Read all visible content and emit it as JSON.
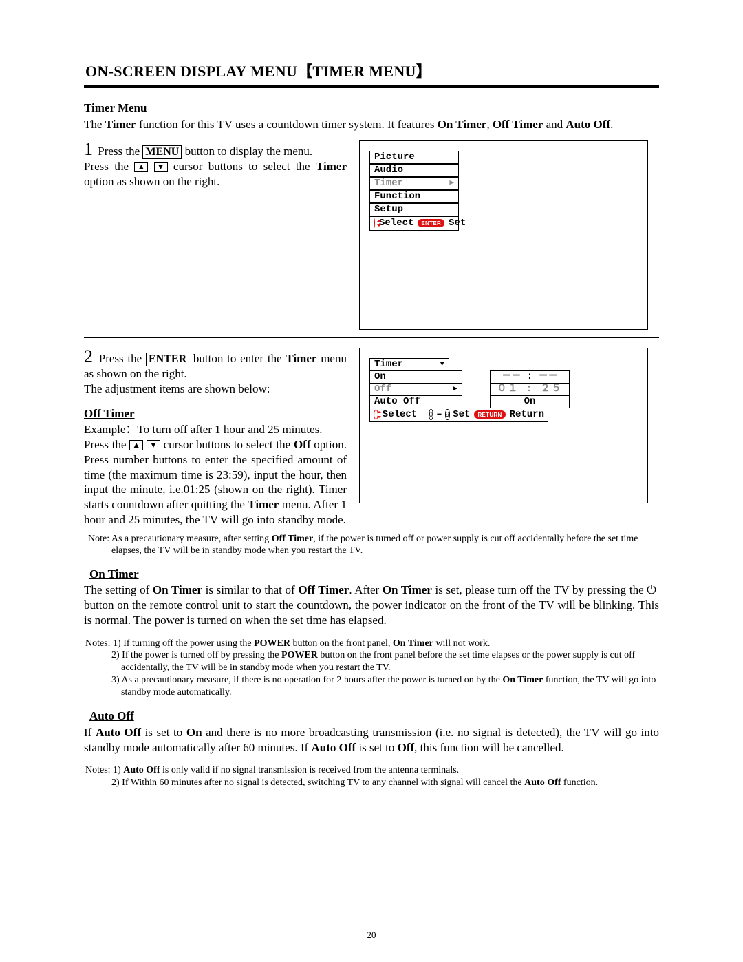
{
  "heading": "ON-SCREEN DISPLAY MENU【TIMER MENU】",
  "subheading": "Timer Menu",
  "intro_pre": "The ",
  "intro_b1": "Timer",
  "intro_mid1": " function for this TV uses a countdown timer system. It features ",
  "intro_b2": "On Timer",
  "intro_mid2": ", ",
  "intro_b3": "Off Timer",
  "intro_mid3": " and ",
  "intro_b4": "Auto Off",
  "intro_end": ".",
  "step1_num": "1",
  "step1_a": " Press the ",
  "step1_menu": "MENU",
  "step1_b": " button to display the menu.",
  "step1_c": "Press the ",
  "step1_d": " cursor buttons to select the ",
  "step1_timer": "Timer",
  "step1_e": " option as shown on the right.",
  "arrow_up": "▲",
  "arrow_down": "▼",
  "arrow_right": "▶",
  "menu1": {
    "items": [
      "Picture",
      "Audio",
      "Timer",
      "Function",
      "Setup"
    ],
    "status_select": "Select",
    "status_enter": "ENTER",
    "status_set": "Set"
  },
  "step2_num": "2",
  "step2_a": " Press the ",
  "step2_enter": "ENTER",
  "step2_b": " button to enter the ",
  "step2_timer": "Timer",
  "step2_c": " menu as shown on the right.",
  "step2_d": "The adjustment items are shown below:",
  "off_timer_title": "Off Timer",
  "off_timer_example": "Example：To turn off after 1 hour and 25 minutes.",
  "off_timer_p_a": "Press the ",
  "off_timer_p_b": " cursor buttons to select the ",
  "off_timer_off": "Off",
  "off_timer_p_c": " option. Press number buttons to enter the specified amount of time (the maximum time is 23:59), input the hour, then input the minute, i.e.01:25 (shown on the right). Timer starts countdown after quitting the ",
  "off_timer_timer": "Timer",
  "off_timer_p_d": " menu. After 1 hour and 25 minutes, the TV will go into standby mode.",
  "menu2": {
    "header": "Timer",
    "rows": [
      {
        "label": "On",
        "value": "－－ : －－"
      },
      {
        "label": "Off",
        "value": "０１ : ２５",
        "gray": true
      },
      {
        "label": "Auto Off",
        "value": "On"
      }
    ],
    "status_select": "Select",
    "status_set": "Set",
    "status_return_pill": "RETURN",
    "status_return": "Return",
    "zero": "0",
    "nine": "9"
  },
  "note1_pre": "Note: As a precautionary measure, after setting ",
  "note1_b": "Off Timer",
  "note1_post": ", if the power is turned off or power supply is cut off accidentally before the set time elapses, the TV will be in standby mode when you restart the TV.",
  "on_timer_title": "On Timer",
  "on_timer_a": "The setting of ",
  "on_timer_b1": "On Timer",
  "on_timer_b": " is similar to that of ",
  "on_timer_b2": "Off Timer",
  "on_timer_c": ". After ",
  "on_timer_b3": "On Timer",
  "on_timer_d": " is set, please turn off the TV by pressing the ",
  "on_timer_e": " button on the remote control unit to start the countdown, the power indicator on the front of the TV will be blinking. This is normal. The power is turned on when the set time has elapsed.",
  "notes2_line1_pre": "Notes: 1) If turning off the power using the ",
  "notes2_line1_b1": "POWER",
  "notes2_line1_mid": " button on the front panel, ",
  "notes2_line1_b2": "On Timer",
  "notes2_line1_post": " will not work.",
  "notes2_line2_pre": "2) If the power is turned off by pressing the ",
  "notes2_line2_b1": "POWER",
  "notes2_line2_post": " button on the front panel before the set time elapses or the power supply is cut off accidentally, the TV will be in standby mode when you restart the TV.",
  "notes2_line3_pre": "3) As a precautionary measure, if there is no operation for 2 hours after the power is turned on by the ",
  "notes2_line3_b1": "On Timer",
  "notes2_line3_post": " function, the TV will go into standby mode automatically.",
  "auto_off_title": "Auto Off",
  "auto_off_a": "If ",
  "auto_off_b1": "Auto Off",
  "auto_off_b": " is set to ",
  "auto_off_b2": "On",
  "auto_off_c": " and there is no more broadcasting transmission (i.e. no signal is detected), the TV will go into standby mode automatically after 60 minutes. If ",
  "auto_off_b3": "Auto Off",
  "auto_off_d": " is set to ",
  "auto_off_b4": "Off",
  "auto_off_e": ", this function will be cancelled.",
  "notes3_line1_pre": "Notes: 1) ",
  "notes3_line1_b1": "Auto Off",
  "notes3_line1_post": " is only valid if no signal transmission is received from the antenna terminals.",
  "notes3_line2_pre": "2) If Within 60 minutes after no signal is detected, switching TV to any channel with signal will cancel the ",
  "notes3_line2_b1": "Auto Off",
  "notes3_line2_post": " function.",
  "page_number": "20"
}
